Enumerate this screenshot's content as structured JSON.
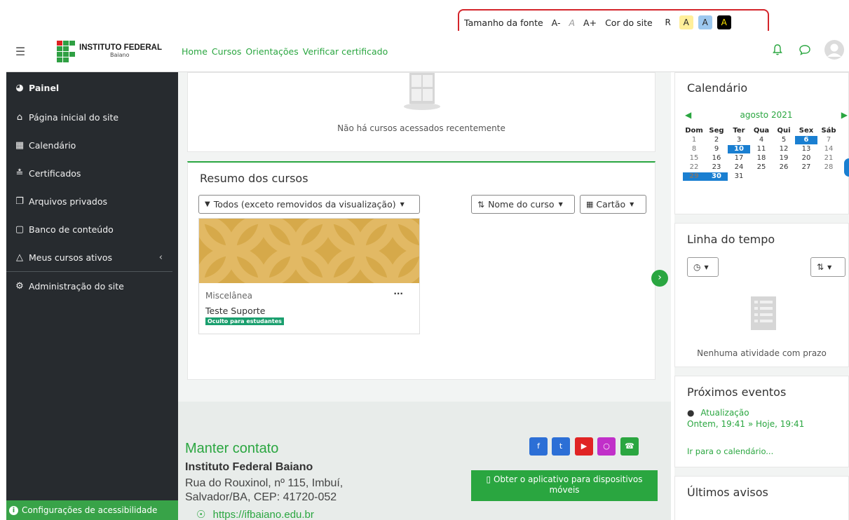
{
  "accessibility_bar": {
    "font_size_label": "Tamanho da fonte",
    "font_decrease": "A-",
    "font_normal": "A",
    "font_increase": "A+",
    "site_color_label": "Cor do site",
    "color_reset": "R",
    "color_yellow": "A",
    "color_blue": "A",
    "color_black": "A"
  },
  "navbar": {
    "logo_name": "INSTITUTO FEDERAL",
    "logo_sub": "Baiano",
    "links": [
      "Home",
      "Cursos",
      "Orientações",
      "Verificar certificado"
    ]
  },
  "sidebar": {
    "items": [
      {
        "label": "Painel",
        "icon": "dashboard-icon"
      },
      {
        "label": "Página inicial do site",
        "icon": "home-icon"
      },
      {
        "label": "Calendário",
        "icon": "calendar-icon"
      },
      {
        "label": "Certificados",
        "icon": "certificate-icon"
      },
      {
        "label": "Arquivos privados",
        "icon": "files-icon"
      },
      {
        "label": "Banco de conteúdo",
        "icon": "content-bank-icon"
      },
      {
        "label": "Meus cursos ativos",
        "icon": "courses-icon"
      },
      {
        "label": "Administração do site",
        "icon": "admin-gear-icon"
      }
    ],
    "footer": "Configurações de acessibilidade"
  },
  "main": {
    "recent_empty": "Não há cursos acessados recentemente",
    "overview": {
      "title": "Resumo dos cursos",
      "filter": "Todos (exceto removidos da visualização)",
      "sort": "Nome do curso",
      "view": "Cartão",
      "course": {
        "category": "Miscelânea",
        "name": "Teste Suporte",
        "badge": "Oculto para estudantes"
      }
    }
  },
  "footer": {
    "contact_title": "Manter contato",
    "org": "Instituto Federal Baiano",
    "address_line1": "Rua do Rouxinol, nº 115, Imbuí,",
    "address_line2": "Salvador/BA, CEP: 41720-052",
    "url": "https://ifbaiano.edu.br",
    "app_button": "Obter o aplicativo para dispositivos móveis",
    "social": [
      "facebook-icon",
      "twitter-icon",
      "youtube-icon",
      "instagram-icon",
      "whatsapp-icon"
    ],
    "social_colors": [
      "#2c6fd6",
      "#2c6fd6",
      "#e02424",
      "#c130c9",
      "#2aa640"
    ]
  },
  "right": {
    "calendar": {
      "title": "Calendário",
      "month": "agosto 2021",
      "days": [
        "Dom",
        "Seg",
        "Ter",
        "Qua",
        "Qui",
        "Sex",
        "Sáb"
      ],
      "weeks": [
        [
          "1",
          "2",
          "3",
          "4",
          "5",
          "6",
          "7"
        ],
        [
          "8",
          "9",
          "10",
          "11",
          "12",
          "13",
          "14"
        ],
        [
          "15",
          "16",
          "17",
          "18",
          "19",
          "20",
          "21"
        ],
        [
          "22",
          "23",
          "24",
          "25",
          "26",
          "27",
          "28"
        ],
        [
          "29",
          "30",
          "31",
          "",
          "",
          "",
          ""
        ]
      ],
      "highlighted": [
        "6",
        "10",
        "29",
        "30"
      ]
    },
    "timeline": {
      "title": "Linha do tempo",
      "empty": "Nenhuma atividade com prazo"
    },
    "events": {
      "title": "Próximos eventos",
      "event_name": "Atualização",
      "event_time": "Ontem, 19:41 » Hoje, 19:41",
      "link": "Ir para o calendário..."
    },
    "announcements": {
      "title": "Últimos avisos"
    }
  },
  "colors": {
    "brand_green": "#2aa640",
    "sidebar_bg": "#272b2f",
    "calendar_highlight": "#1a7fd1",
    "accessibility_border": "#d4252b"
  }
}
